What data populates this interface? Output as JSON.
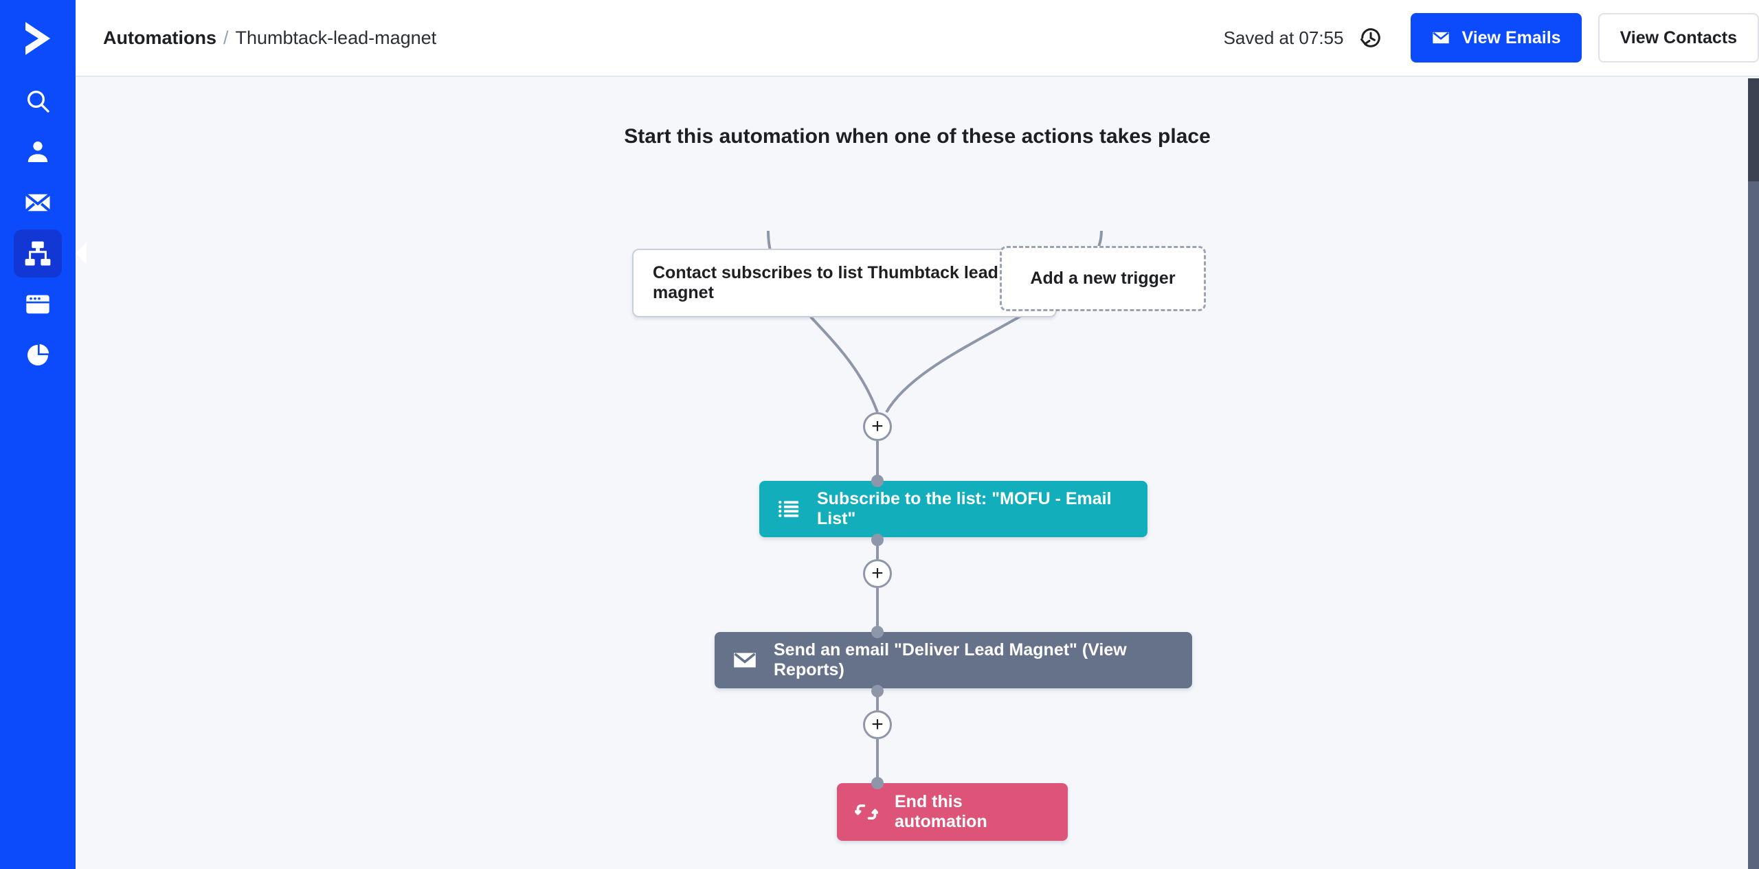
{
  "app": {
    "brand_blue": "#0b4bfc",
    "canvas_bg": "#f5f7fb",
    "logo_name": "activecampaign-logo"
  },
  "sidebar": {
    "items": [
      {
        "icon": "search-icon",
        "name": "search",
        "active": false
      },
      {
        "icon": "person-icon",
        "name": "contacts",
        "active": false
      },
      {
        "icon": "envelope-icon",
        "name": "campaigns",
        "active": false
      },
      {
        "icon": "sitemap-icon",
        "name": "automations",
        "active": true
      },
      {
        "icon": "browser-icon",
        "name": "pages",
        "active": false
      },
      {
        "icon": "pie-chart-icon",
        "name": "reports",
        "active": false
      }
    ]
  },
  "header": {
    "breadcrumb_root": "Automations",
    "breadcrumb_separator": "/",
    "breadcrumb_current": "Thumbtack-lead-magnet",
    "saved_status": "Saved at 07:55",
    "history_icon": "history-clock-icon",
    "view_emails_label": "View Emails",
    "view_emails_icon": "envelope-icon",
    "view_emails_color": "#0b4bfc",
    "view_contacts_label": "View Contacts"
  },
  "flow": {
    "title": "Start this automation when one of these actions takes place",
    "triggers": [
      {
        "label": "Contact subscribes to list Thumbtack lead magnet",
        "style": "solid"
      },
      {
        "label": "Add a new trigger",
        "style": "dashed"
      }
    ],
    "add_buttons": [
      {
        "label": "+",
        "name": "add-step-after-triggers"
      },
      {
        "label": "+",
        "name": "add-step-after-subscribe"
      },
      {
        "label": "+",
        "name": "add-step-after-email"
      }
    ],
    "actions": [
      {
        "label": "Subscribe to the list: \"MOFU - Email List\"",
        "icon": "list-icon",
        "color": "#13aebc",
        "name": "action-subscribe-to-list"
      },
      {
        "label": "Send an email \"Deliver Lead Magnet\" (View Reports)",
        "icon": "envelope-icon",
        "color": "#66718a",
        "name": "action-send-email"
      },
      {
        "label": "End this automation",
        "icon": "end-arrows-icon",
        "color": "#dd5478",
        "name": "action-end-automation"
      }
    ]
  }
}
